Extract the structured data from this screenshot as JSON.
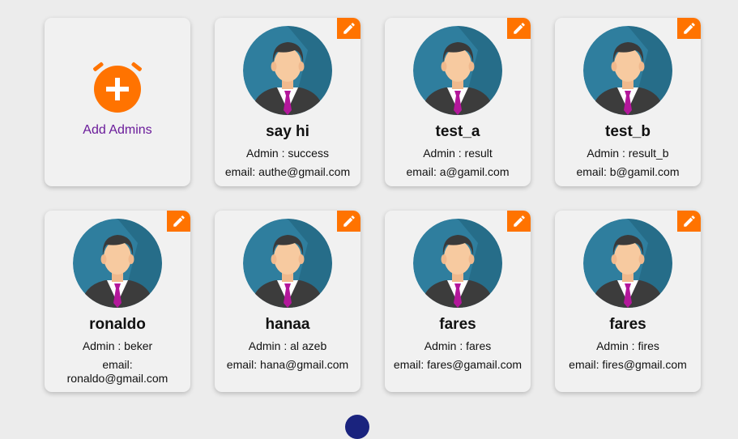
{
  "add_card": {
    "label": "Add Admins",
    "icon": "alarm-add-icon"
  },
  "admins": [
    {
      "name": "say hi",
      "role": "Admin : success",
      "email": "email: authe@gmail.com"
    },
    {
      "name": "test_a",
      "role": "Admin : result",
      "email": "email: a@gamil.com"
    },
    {
      "name": "test_b",
      "role": "Admin : result_b",
      "email": "email: b@gamil.com"
    },
    {
      "name": "ronaldo",
      "role": "Admin : beker",
      "email": "email: ronaldo@gmail.com"
    },
    {
      "name": "hanaa",
      "role": "Admin : al azeb",
      "email": "email: hana@gmail.com"
    },
    {
      "name": "fares",
      "role": "Admin : fares",
      "email": "email: fares@gamail.com"
    },
    {
      "name": "fares",
      "role": "Admin : fires",
      "email": "email: fires@gmail.com"
    }
  ],
  "colors": {
    "accent": "#ff7300",
    "link": "#6a1b9a",
    "card": "#f1f1f1",
    "background": "#ececec"
  },
  "icons": {
    "edit": "pencil-icon",
    "avatar": "user-avatar-icon"
  }
}
